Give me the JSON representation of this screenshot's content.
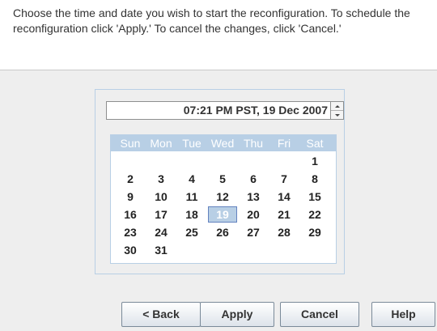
{
  "intro": {
    "text": "Choose the time and date you wish to start the reconfiguration.  To schedule the reconfiguration click 'Apply.'  To cancel the changes, click 'Cancel.'"
  },
  "spinner": {
    "value": "07:21 PM PST, 19 Dec 2007"
  },
  "calendar": {
    "weekdays": [
      "Sun",
      "Mon",
      "Tue",
      "Wed",
      "Thu",
      "Fri",
      "Sat"
    ],
    "weeks": [
      [
        "",
        "",
        "",
        "",
        "",
        "",
        "1"
      ],
      [
        "2",
        "3",
        "4",
        "5",
        "6",
        "7",
        "8"
      ],
      [
        "9",
        "10",
        "11",
        "12",
        "13",
        "14",
        "15"
      ],
      [
        "16",
        "17",
        "18",
        "19",
        "20",
        "21",
        "22"
      ],
      [
        "23",
        "24",
        "25",
        "26",
        "27",
        "28",
        "29"
      ],
      [
        "30",
        "31",
        "",
        "",
        "",
        "",
        ""
      ]
    ],
    "selected_day": "19"
  },
  "buttons": {
    "back": "< Back",
    "apply": "Apply",
    "cancel": "Cancel",
    "help": "Help"
  },
  "colors": {
    "calendar_header": "#b8cfe5",
    "selected_day_border": "#6382bf",
    "background": "#eeeeee"
  }
}
